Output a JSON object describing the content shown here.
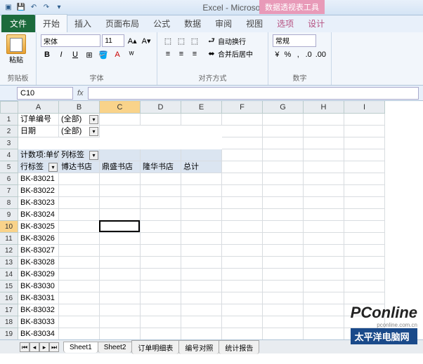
{
  "app": {
    "title": "Excel - Microsoft Excel",
    "context_badge": "数据透视表工具"
  },
  "tabs": {
    "file": "文件",
    "home": "开始",
    "insert": "插入",
    "layout": "页面布局",
    "formulas": "公式",
    "data": "数据",
    "review": "审阅",
    "view": "视图",
    "options": "选项",
    "design": "设计"
  },
  "ribbon": {
    "clipboard": {
      "label": "剪贴板",
      "paste": "粘贴"
    },
    "font": {
      "label": "字体",
      "name": "宋体",
      "size": "11",
      "bold": "B",
      "italic": "I",
      "underline": "U"
    },
    "align": {
      "label": "对齐方式",
      "wrap": "自动换行",
      "merge": "合并后居中"
    },
    "number": {
      "label": "数字",
      "format": "常规"
    }
  },
  "namebox": "C10",
  "columns": [
    "A",
    "B",
    "C",
    "D",
    "E",
    "F",
    "G",
    "H",
    "I"
  ],
  "rows": [
    "1",
    "2",
    "3",
    "4",
    "5",
    "6",
    "7",
    "8",
    "9",
    "10",
    "11",
    "12",
    "13",
    "14",
    "15",
    "16",
    "17",
    "18",
    "19"
  ],
  "filters": {
    "a1": "订单编号",
    "b1": "(全部)",
    "a2": "日期",
    "b2": "(全部)"
  },
  "pivot": {
    "a4": "计数项:单价",
    "b4": "列标签",
    "a5": "行标签",
    "b5": "博达书店",
    "c5": "鼎盛书店",
    "d5": "隆华书店",
    "e5": "总计"
  },
  "rowitems": [
    "BK-83021",
    "BK-83022",
    "BK-83023",
    "BK-83024",
    "BK-83025",
    "BK-83026",
    "BK-83027",
    "BK-83028",
    "BK-83029",
    "BK-83030",
    "BK-83031",
    "BK-83032",
    "BK-83033",
    "BK-83034"
  ],
  "sheets": {
    "s1": "Sheet1",
    "s2": "Sheet2",
    "s3": "订单明细表",
    "s4": "编号对照",
    "s5": "统计报告"
  },
  "watermark": {
    "logo": "PConline",
    "sub": "太平洋电脑网",
    "dom": "pconline.com.cn"
  }
}
